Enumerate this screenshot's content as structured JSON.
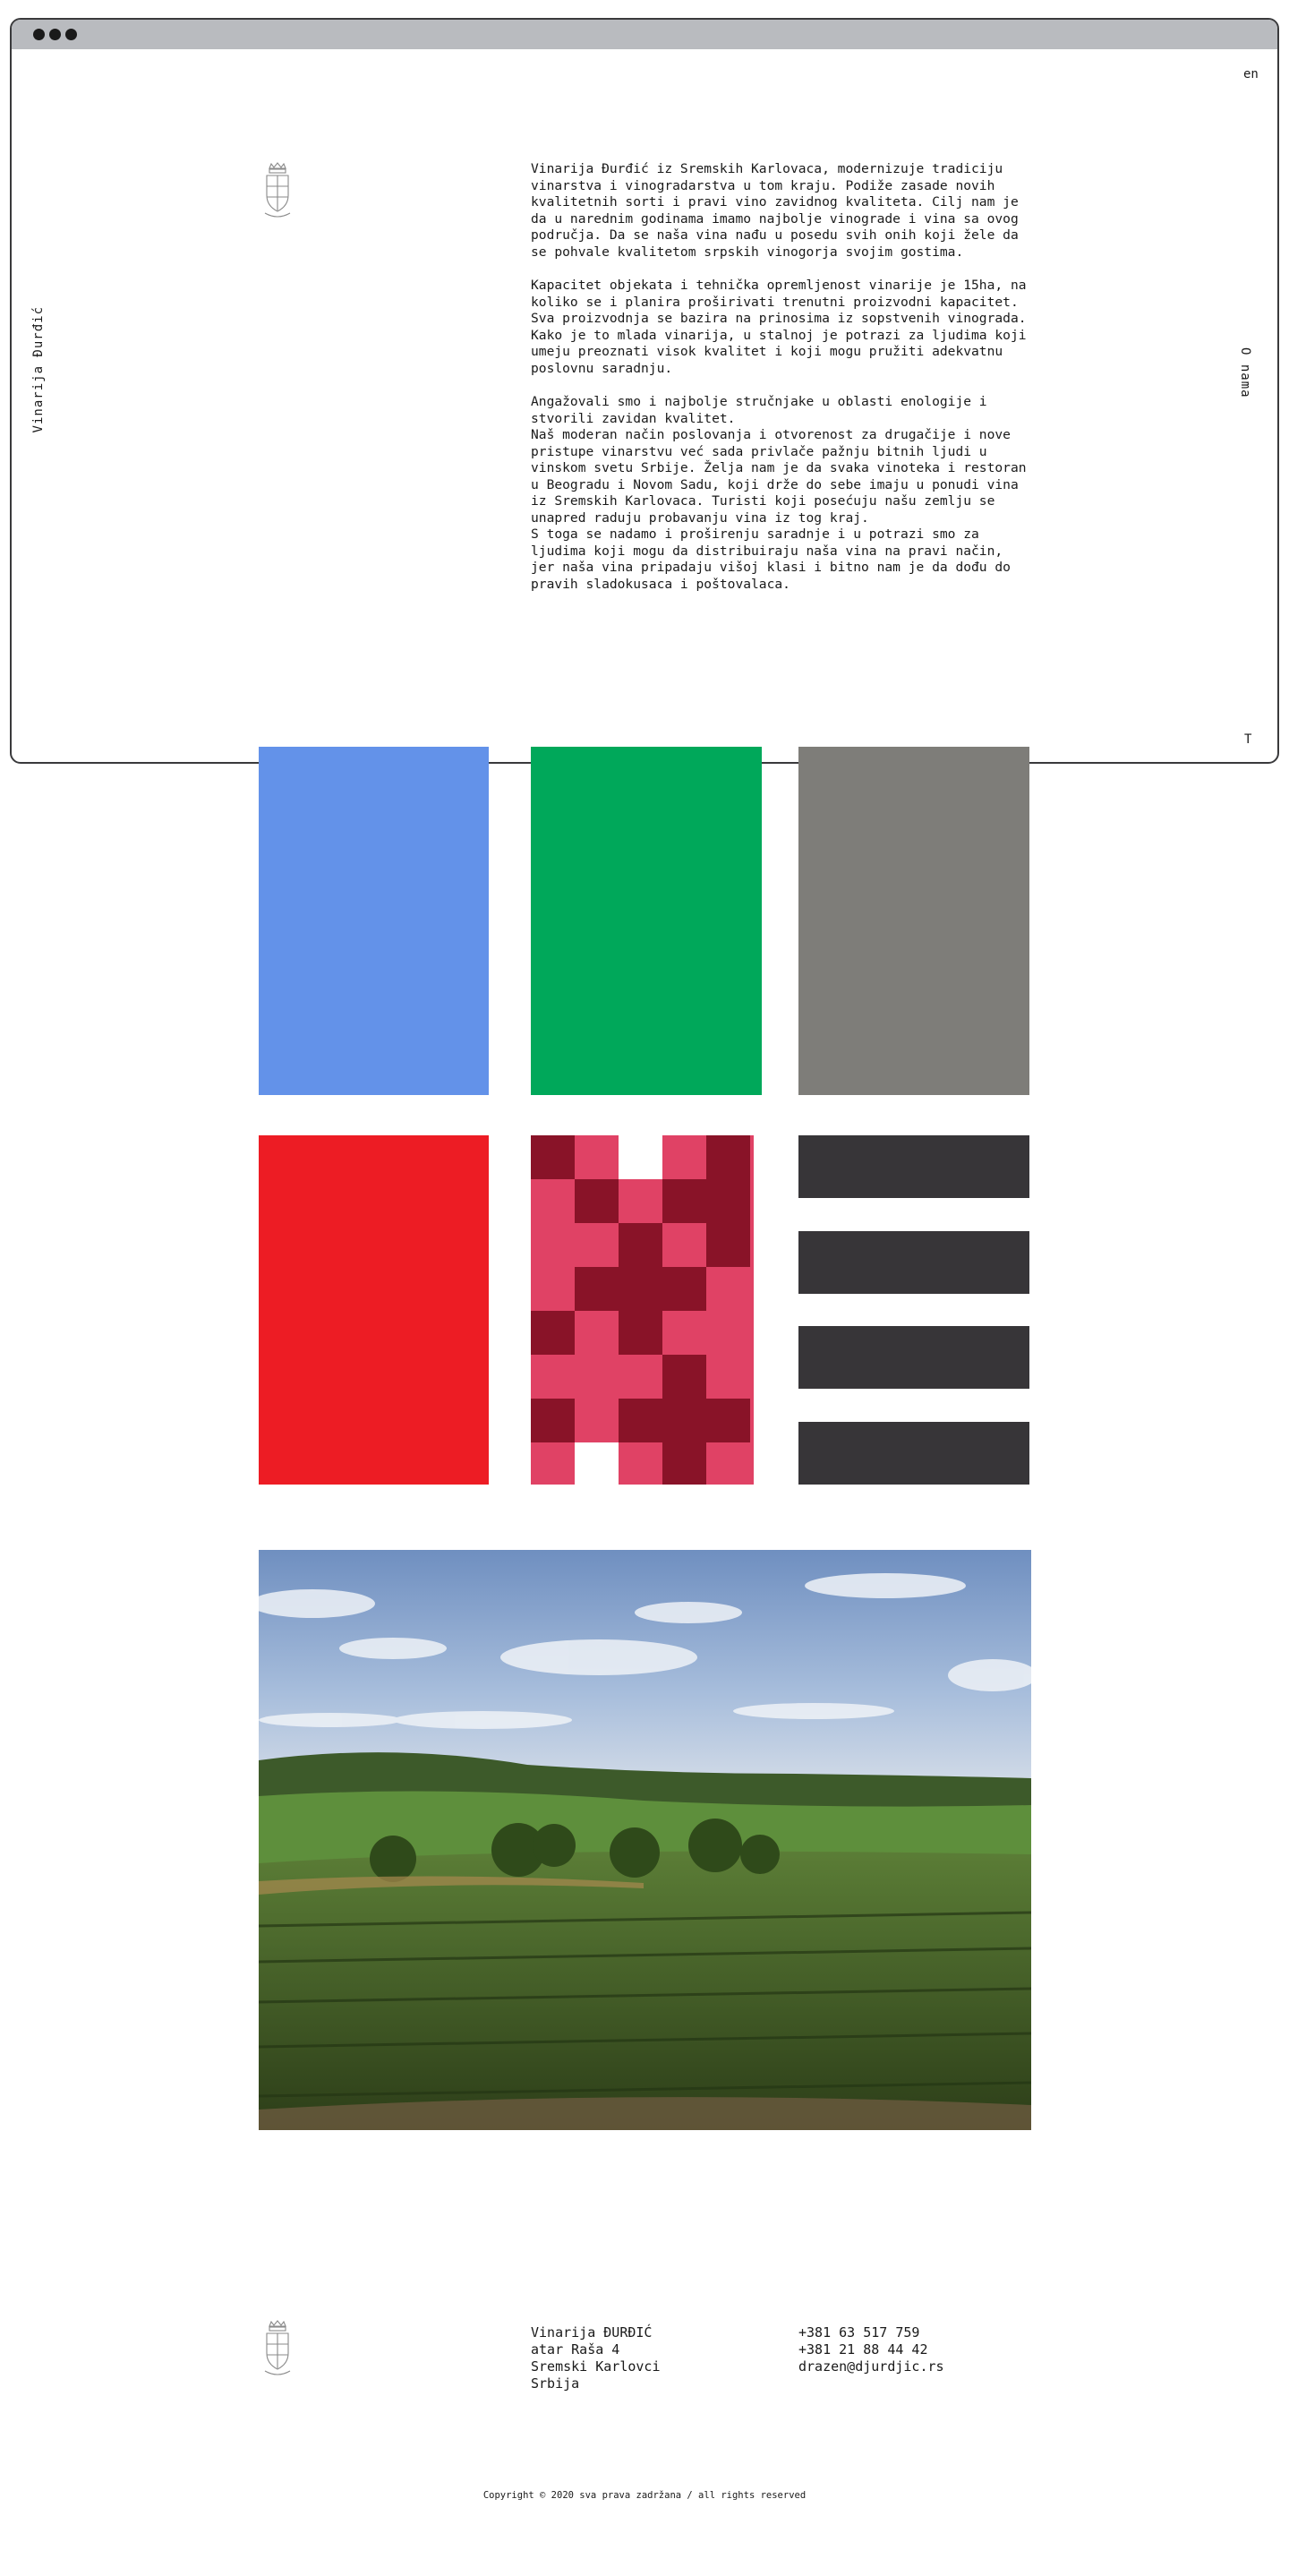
{
  "nav": {
    "lang": "en",
    "about": "O nama",
    "top": "T",
    "brand_vertical": "Vinarija Đurđić"
  },
  "intro": {
    "paragraphs": [
      "Vinarija Đurđić iz Sremskih Karlovaca, modernizuje tradiciju vinarstva i vinogradarstva u tom kraju. Podiže zasade novih kvalitetnih sorti i pravi vino zavidnog kvaliteta. Cilj nam je da u narednim godinama imamo najbolje vinograde i vina sa ovog područja. Da se naša vina nađu u posedu svih onih koji žele da se pohvale kvalitetom srpskih vinogorja svojim gostima.",
      "Kapacitet objekata i tehnička opremljenost vinarije je 15ha, na koliko se i planira proširivati trenutni proizvodni kapacitet. Sva proizvodnja se bazira na prinosima iz sopstvenih vinograda. Kako je to mlada vinarija, u stalnoj je potrazi za ljudima koji umeju preoznati visok kvalitet i koji mogu pružiti adekvatnu poslovnu saradnju.",
      "Angažovali smo i najbolje stručnjake u oblasti enologije i stvorili zavidan kvalitet.\nNaš moderan način poslovanja i otvorenost za drugačije i nove pristupe vinarstvu već sada privlače pažnju bitnih ljudi u vinskom svetu Srbije. Želja nam je da svaka vinoteka i restoran u Beogradu i Novom Sadu, koji drže do sebe imaju u ponudi vina iz Sremskih Karlovaca. Turisti koji posećuju našu zemlju se unapred raduju probavanju vina iz tog kraj.\nS toga se nadamo i proširenju saradnje i u potrazi smo za ljudima koji mogu da distribuiraju naša vina na pravi način, jer naša vina pripadaju višoj klasi i bitno nam je da dođu do pravih sladokusaca i poštovalaca."
    ]
  },
  "palette": {
    "blue": "#6392e9",
    "green": "#00a85a",
    "grey": "#7e7d79",
    "red": "#ed1c24",
    "pink": "#e04265",
    "maroon": "#891328",
    "dark": "#373538"
  },
  "footer": {
    "address": [
      "Vinarija ĐURĐIĆ",
      "atar Raša 4",
      "Sremski Karlovci",
      "Srbija"
    ],
    "contact": [
      "+381 63 517 759",
      "+381 21 88 44 42",
      "drazen@djurdjic.rs"
    ],
    "copyright": "Copyright © 2020 sva prava zadržana / all rights reserved"
  }
}
